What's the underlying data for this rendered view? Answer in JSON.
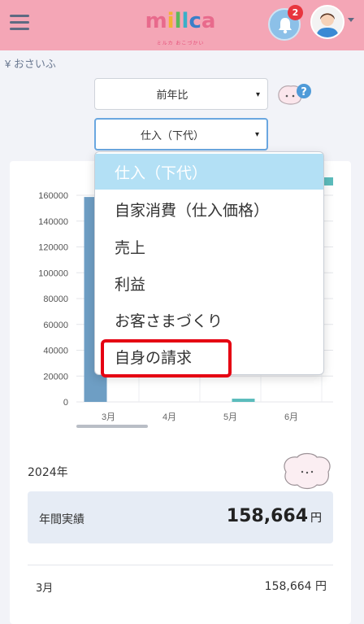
{
  "header": {
    "logo_text": "millca",
    "logo_tagline": "ミルカ おこづかい",
    "notification_count": "2"
  },
  "page": {
    "section_label": "¥ おさいふ"
  },
  "filters": {
    "compare_selected": "前年比",
    "category_selected": "仕入（下代）"
  },
  "dropdown": {
    "options": [
      "仕入（下代）",
      "自家消費（仕入価格）",
      "売上",
      "利益",
      "お客さまづくり",
      "自身の請求"
    ],
    "selected_index": 0,
    "highlighted_index": 5
  },
  "chart_data": {
    "type": "bar",
    "categories": [
      "3月",
      "4月",
      "5月",
      "6月"
    ],
    "y_ticks": [
      "160000",
      "140000",
      "120000",
      "100000",
      "80000",
      "60000",
      "40000",
      "20000",
      "0"
    ],
    "ylim": [
      0,
      160000
    ],
    "series": [
      {
        "color": "#6e9ec4",
        "values": [
          158664,
          0,
          0,
          0
        ]
      },
      {
        "color": "#5bbcbc",
        "values": [
          0,
          0,
          2500,
          0
        ]
      }
    ]
  },
  "summary": {
    "year": "2024年",
    "annual_label": "年間実績",
    "annual_value": "158,664",
    "annual_unit": "円",
    "rows": [
      {
        "month": "3月",
        "value": "158,664 円"
      }
    ]
  },
  "colors": {
    "header_bg": "#f4a6b6",
    "selected_option_bg": "#b3e0f5",
    "highlight_border": "#e50012"
  }
}
